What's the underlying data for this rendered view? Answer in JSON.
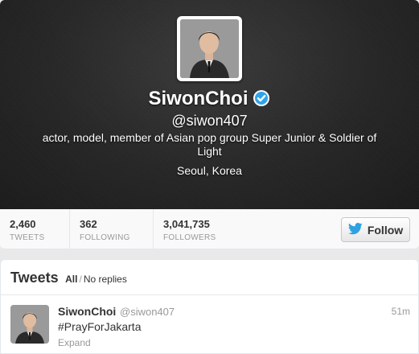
{
  "profile": {
    "name": "SiwonChoi",
    "verified_icon": "verified-badge-icon",
    "handle": "@siwon407",
    "bio": "actor, model, member of Asian pop group Super Junior & Soldier of Light",
    "location": "Seoul, Korea"
  },
  "stats": {
    "tweets": {
      "value": "2,460",
      "label": "TWEETS"
    },
    "following": {
      "value": "362",
      "label": "FOLLOWING"
    },
    "followers": {
      "value": "3,041,735",
      "label": "FOLLOWERS"
    }
  },
  "follow_button": {
    "label": "Follow",
    "icon": "twitter-bird-icon"
  },
  "tweets_section": {
    "title": "Tweets",
    "filter_all": "All",
    "filter_separator": "/",
    "filter_no_replies": "No replies"
  },
  "tweets": [
    {
      "name": "SiwonChoi",
      "handle": "@siwon407",
      "time": "51m",
      "text": "#PrayForJakarta",
      "expand": "Expand"
    }
  ],
  "colors": {
    "verified_blue": "#2fa4e7",
    "twitter_blue": "#2ea1e0"
  }
}
